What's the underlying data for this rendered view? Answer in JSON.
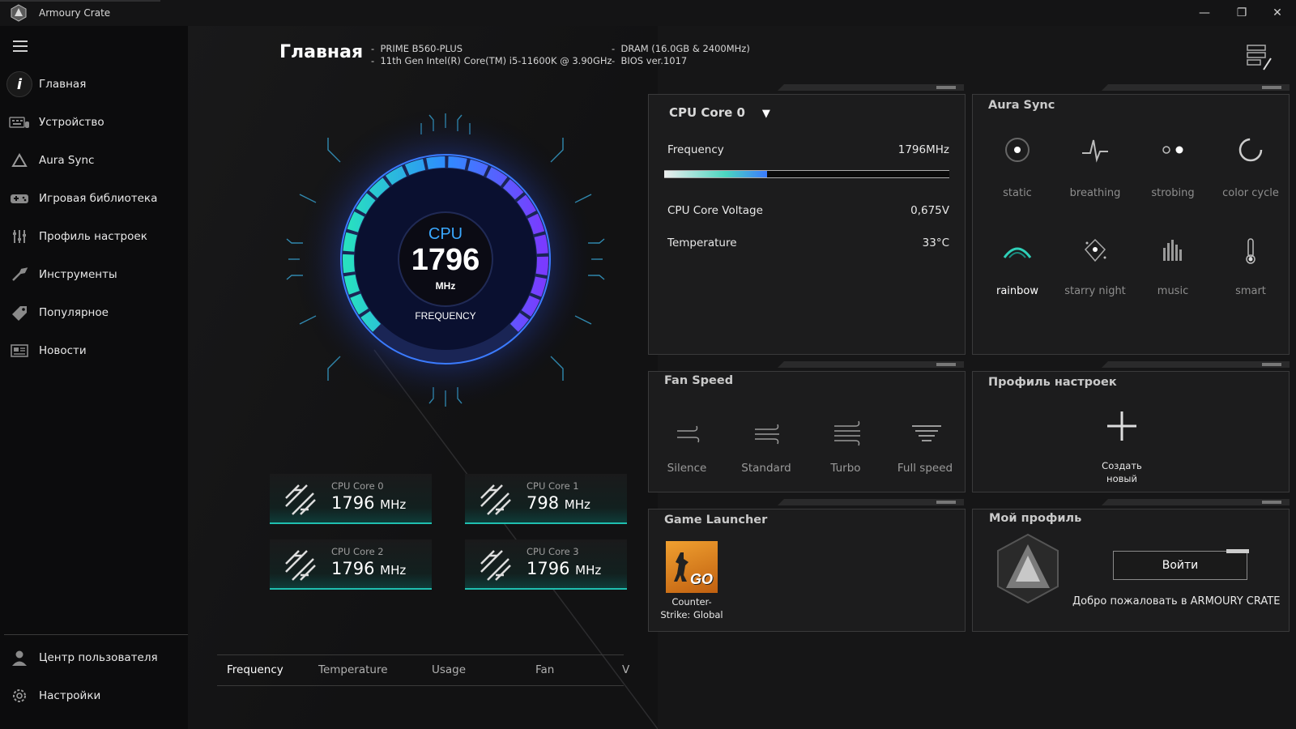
{
  "window": {
    "title": "Armoury Crate",
    "minimize": "—",
    "maximize": "❐",
    "close": "✕"
  },
  "sidebar": {
    "items": [
      {
        "label": "Главная",
        "icon": "info-icon"
      },
      {
        "label": "Устройство",
        "icon": "keyboard-icon"
      },
      {
        "label": "Aura Sync",
        "icon": "aura-triangle-icon"
      },
      {
        "label": "Игровая библиотека",
        "icon": "gamepad-icon"
      },
      {
        "label": "Профиль настроек",
        "icon": "sliders-icon"
      },
      {
        "label": "Инструменты",
        "icon": "wrench-icon"
      },
      {
        "label": "Популярное",
        "icon": "tag-icon"
      },
      {
        "label": "Новости",
        "icon": "news-icon"
      }
    ],
    "bottom": [
      {
        "label": "Центр пользователя",
        "icon": "user-icon"
      },
      {
        "label": "Настройки",
        "icon": "gear-icon"
      }
    ]
  },
  "header": {
    "title": "Главная",
    "specs_left": [
      "PRIME B560-PLUS",
      "11th Gen Intel(R) Core(TM) i5-11600K @ 3.90GHz"
    ],
    "specs_right": [
      "DRAM (16.0GB & 2400MHz)",
      "BIOS ver.1017"
    ],
    "bullet": "-"
  },
  "gauge": {
    "label": "CPU",
    "value": "1796",
    "unit": "MHz",
    "caption": "FREQUENCY",
    "level": 0.47
  },
  "cores": [
    {
      "name": "CPU Core 0",
      "value": "1796",
      "unit": "MHz"
    },
    {
      "name": "CPU Core 1",
      "value": "798",
      "unit": "MHz"
    },
    {
      "name": "CPU Core 2",
      "value": "1796",
      "unit": "MHz"
    },
    {
      "name": "CPU Core 3",
      "value": "1796",
      "unit": "MHz"
    }
  ],
  "tabs": [
    "Frequency",
    "Temperature",
    "Usage",
    "Fan",
    "V"
  ],
  "cpu_panel": {
    "selector": "CPU Core 0",
    "selector_arrow": "▼",
    "rows": [
      {
        "label": "Frequency",
        "value": "1796MHz"
      },
      {
        "label": "CPU Core Voltage",
        "value": "0,675V"
      },
      {
        "label": "Temperature",
        "value": "33°C"
      }
    ],
    "frequency_level": 0.36
  },
  "aura": {
    "title": "Aura Sync",
    "effects": [
      {
        "label": "static",
        "icon": "static-dot-icon"
      },
      {
        "label": "breathing",
        "icon": "breathing-wave-icon"
      },
      {
        "label": "strobing",
        "icon": "strobing-dots-icon"
      },
      {
        "label": "color cycle",
        "icon": "color-cycle-icon"
      },
      {
        "label": "rainbow",
        "icon": "rainbow-arc-icon"
      },
      {
        "label": "starry night",
        "icon": "starry-night-icon"
      },
      {
        "label": "music",
        "icon": "music-bars-icon"
      },
      {
        "label": "smart",
        "icon": "thermometer-icon"
      }
    ]
  },
  "fan": {
    "title": "Fan Speed",
    "modes": [
      {
        "label": "Silence",
        "icon": "wind-silence-icon"
      },
      {
        "label": "Standard",
        "icon": "wind-standard-icon"
      },
      {
        "label": "Turbo",
        "icon": "wind-turbo-icon"
      },
      {
        "label": "Full speed",
        "icon": "wind-full-icon"
      }
    ]
  },
  "profile": {
    "title": "Профиль настроек",
    "create_line1": "Создать",
    "create_line2": "новый"
  },
  "game_launcher": {
    "title": "Game Launcher",
    "game_badge": "GO",
    "game_line1": "Counter-",
    "game_line2": "Strike: Global"
  },
  "my_profile": {
    "title": "Мой профиль",
    "login": "Войти",
    "welcome": "Добро пожаловать в ARMOURY CRATE"
  },
  "colors": {
    "accent_teal": "#1fbfb0",
    "gauge_blue": "#3b7bff",
    "gauge_purple": "#7a3bff"
  }
}
